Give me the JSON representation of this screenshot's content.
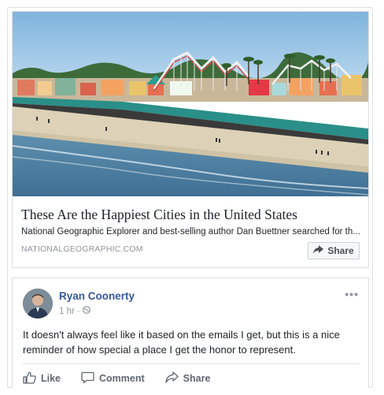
{
  "link_preview": {
    "title": "These Are the Happiest Cities in the United States",
    "description": "National Geographic Explorer and best-selling author Dan Buettner searched for th...",
    "domain": "NATIONALGEOGRAPHIC.COM",
    "share_label": "Share",
    "share_icon": "share-arrow-icon"
  },
  "post": {
    "author": "Ryan Coonerty",
    "time": "1 hr",
    "separator": "·",
    "privacy_icon": "globe-icon",
    "more_label": "•••",
    "text": "It doesn't always feel like it based on the emails I get, but this is a nice reminder of how special a place I get the honor to represent.",
    "actions": {
      "like": "Like",
      "comment": "Comment",
      "share": "Share"
    }
  },
  "colors": {
    "link": "#365899",
    "secondary": "#90949c",
    "action": "#606770",
    "border": "#dddfe2"
  }
}
